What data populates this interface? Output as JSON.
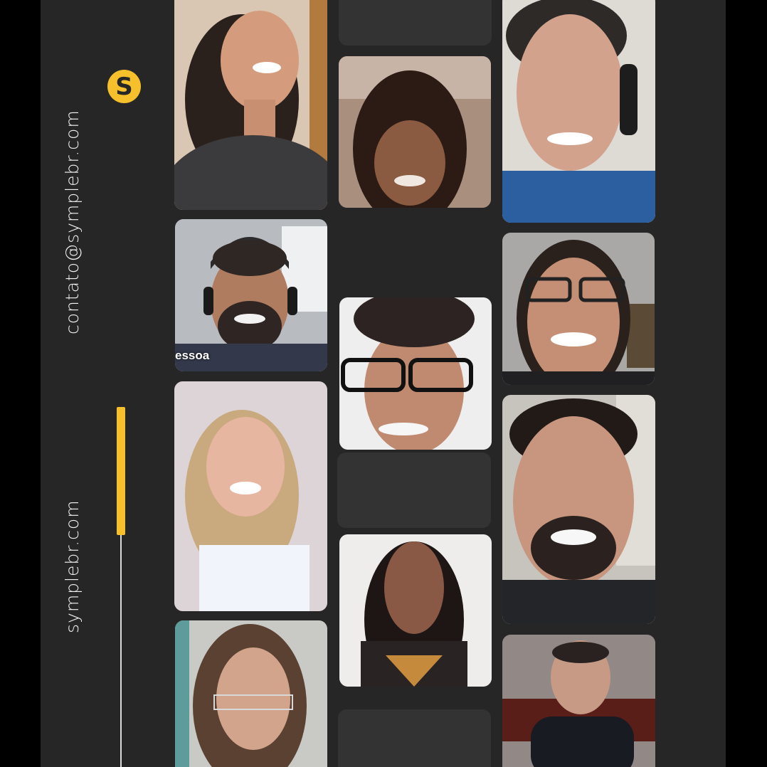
{
  "brand": {
    "logo_letter": "S",
    "accent_color": "#f5c02b",
    "email": "contato@symplebr.com",
    "website": "symplebr.com"
  },
  "participants": [
    {
      "id": "p1",
      "name_tag": ""
    },
    {
      "id": "p2",
      "name_tag": ""
    },
    {
      "id": "p3",
      "name_tag": ""
    },
    {
      "id": "p4",
      "name_tag": "essoa"
    },
    {
      "id": "p5",
      "name_tag": ""
    },
    {
      "id": "p6",
      "name_tag": ""
    },
    {
      "id": "p7",
      "name_tag": ""
    },
    {
      "id": "p8",
      "name_tag": ""
    },
    {
      "id": "p9",
      "name_tag": ""
    },
    {
      "id": "p10",
      "name_tag": ""
    },
    {
      "id": "p11",
      "name_tag": ""
    }
  ]
}
